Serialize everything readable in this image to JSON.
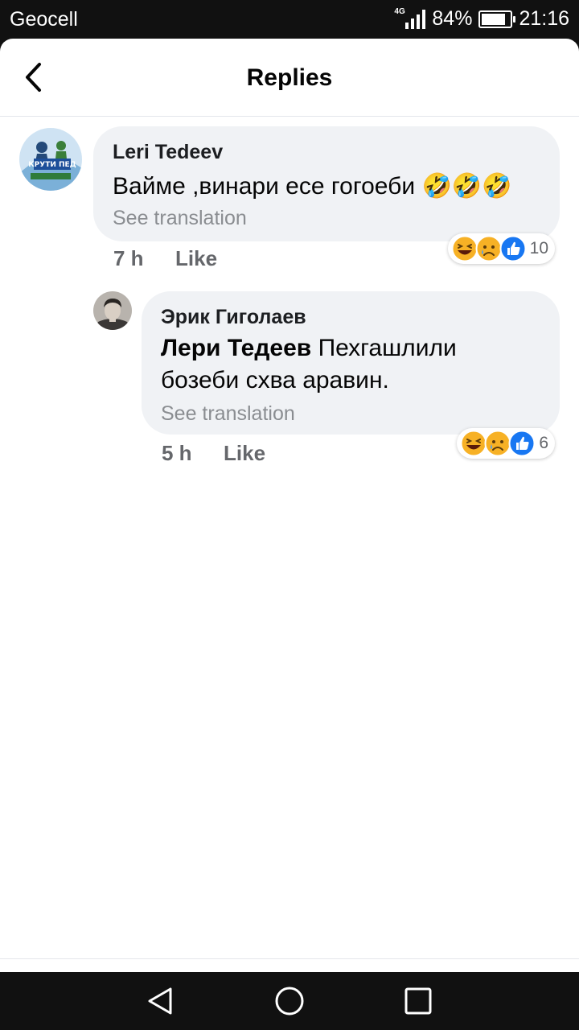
{
  "status_bar": {
    "carrier": "Geocell",
    "network": "4G",
    "battery": "84%",
    "battery_level": 0.84,
    "time": "21:16"
  },
  "header": {
    "title": "Replies"
  },
  "comment": {
    "author": "Leri Tedeev",
    "text": "Вайме ,винари есе гогоеби",
    "emojis": [
      "🤣",
      "🤣",
      "🤣"
    ],
    "see_translation": "See translation",
    "time": "7 h",
    "like_label": "Like",
    "avatar_text": "КРУТИ ПЕД",
    "reaction_count": "10",
    "reaction_icons": [
      "laughing-face-icon",
      "sad-face-icon",
      "thumbs-up-icon"
    ]
  },
  "reply": {
    "author": "Эрик Гиголаев",
    "mention": "Лери Тедеев",
    "text": "Пехгашлили бозеби схва аравин.",
    "see_translation": "See translation",
    "time": "5 h",
    "like_label": "Like",
    "reaction_count": "6",
    "reaction_icons": [
      "laughing-face-icon",
      "sad-face-icon",
      "thumbs-up-icon"
    ]
  },
  "colors": {
    "bubble": "#f0f2f5",
    "like_blue": "#1877f2",
    "emoji_yellow": "#f7b125",
    "secondary_text": "#65676b"
  }
}
